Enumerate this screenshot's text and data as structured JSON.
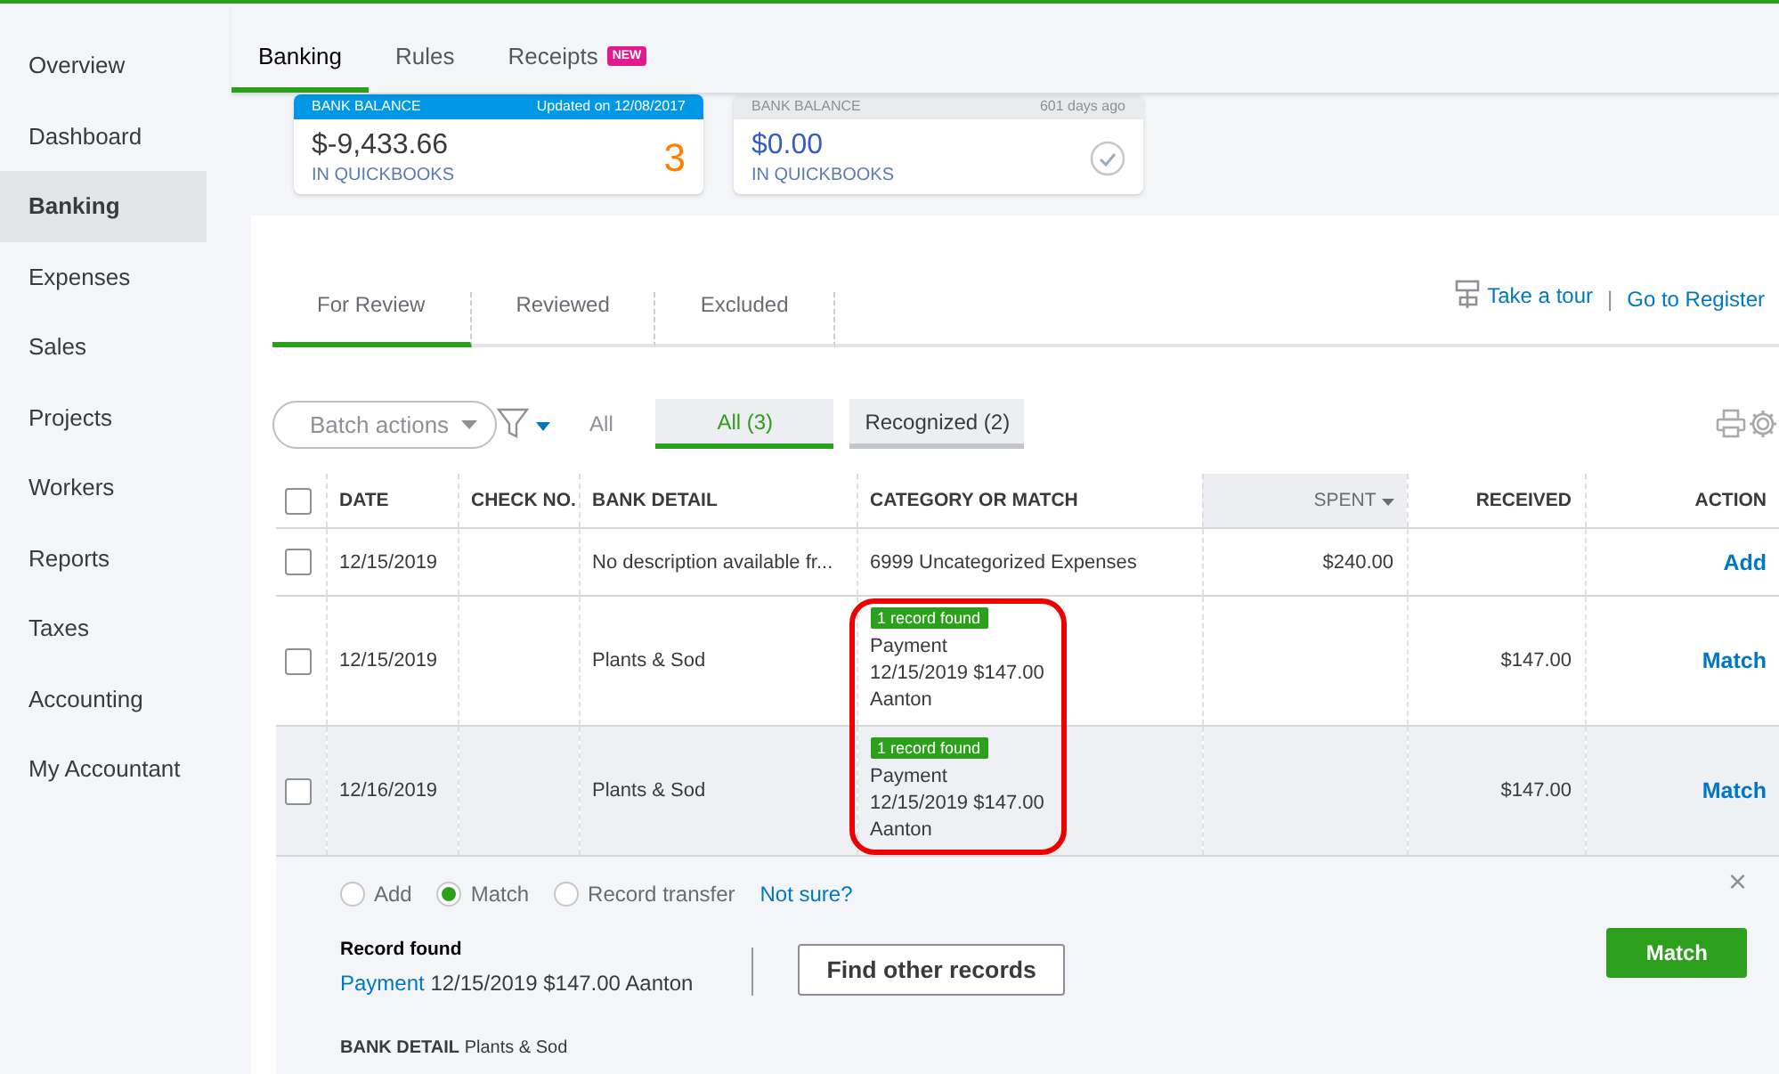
{
  "sidebar": {
    "items": [
      {
        "label": "Overview",
        "selected": false
      },
      {
        "label": "Dashboard",
        "selected": false
      },
      {
        "label": "Banking",
        "selected": true
      },
      {
        "label": "Expenses",
        "selected": false
      },
      {
        "label": "Sales",
        "selected": false
      },
      {
        "label": "Projects",
        "selected": false
      },
      {
        "label": "Workers",
        "selected": false
      },
      {
        "label": "Reports",
        "selected": false
      },
      {
        "label": "Taxes",
        "selected": false
      },
      {
        "label": "Accounting",
        "selected": false
      },
      {
        "label": "My Accountant",
        "selected": false
      }
    ]
  },
  "tabs": [
    {
      "label": "Banking",
      "selected": true
    },
    {
      "label": "Rules",
      "selected": false
    },
    {
      "label": "Receipts",
      "selected": false,
      "badge": "NEW"
    }
  ],
  "accounts": [
    {
      "header": "BANK BALANCE",
      "updated": "Updated on 12/08/2017",
      "amount": "$-9,433.66",
      "caption": "IN QUICKBOOKS",
      "count": "3",
      "selected": true,
      "reconciled": false
    },
    {
      "header": "BANK BALANCE",
      "updated": "601 days ago",
      "amount": "$0.00",
      "caption": "IN QUICKBOOKS",
      "selected": false,
      "reconciled": true
    }
  ],
  "review_tabs": [
    {
      "label": "For Review",
      "selected": true
    },
    {
      "label": "Reviewed",
      "selected": false
    },
    {
      "label": "Excluded",
      "selected": false
    }
  ],
  "links": [
    {
      "label": "Take a tour",
      "kind": "tour"
    },
    {
      "label": "Go to Register",
      "kind": "plain"
    }
  ],
  "link_separator": "|",
  "toolbar": {
    "batch": "Batch actions",
    "filter_label": "All",
    "chips": [
      {
        "label": "All (3)",
        "selected": true
      },
      {
        "label": "Recognized (2)",
        "selected": false
      }
    ]
  },
  "table": {
    "all_checked": false,
    "columns": [
      {
        "label": "DATE",
        "sorted": false
      },
      {
        "label": "CHECK NO.",
        "sorted": false
      },
      {
        "label": "BANK DETAIL",
        "sorted": false
      },
      {
        "label": "CATEGORY OR MATCH",
        "sorted": false
      },
      {
        "label": "SPENT",
        "sorted": true
      },
      {
        "label": "RECEIVED",
        "sorted": false
      },
      {
        "label": "ACTION",
        "sorted": false
      }
    ],
    "rows": [
      {
        "checked": false,
        "expanded": false,
        "highlighted": false,
        "date": "12/15/2019",
        "bank_detail": "No description available fr...",
        "category": {
          "kind": "text",
          "text": "6999 Uncategorized Expenses"
        },
        "spent": "$240.00",
        "action": "Add"
      },
      {
        "checked": false,
        "expanded": false,
        "highlighted": true,
        "date": "12/15/2019",
        "bank_detail": "Plants & Sod",
        "category": {
          "kind": "match",
          "badge": "1 record found",
          "lines": [
            "Payment",
            "12/15/2019 $147.00",
            "Aanton"
          ]
        },
        "received": "$147.00",
        "action": "Match"
      },
      {
        "checked": false,
        "expanded": true,
        "highlighted": true,
        "date": "12/16/2019",
        "bank_detail": "Plants & Sod",
        "category": {
          "kind": "match",
          "badge": "1 record found",
          "lines": [
            "Payment",
            "12/15/2019 $147.00",
            "Aanton"
          ]
        },
        "received": "$147.00",
        "action": "Match"
      }
    ]
  },
  "detail": {
    "options": [
      {
        "label": "Add",
        "selected": false
      },
      {
        "label": "Match",
        "selected": true
      },
      {
        "label": "Record transfer",
        "selected": false
      }
    ],
    "help_link": "Not sure?",
    "close": "×",
    "record_title": "Record found",
    "record_link": "Payment",
    "record_text": "12/15/2019 $147.00 Aanton",
    "find_button": "Find other records",
    "match_button": "Match",
    "bank_detail_label": "BANK DETAIL",
    "bank_detail": "Plants & Sod"
  }
}
